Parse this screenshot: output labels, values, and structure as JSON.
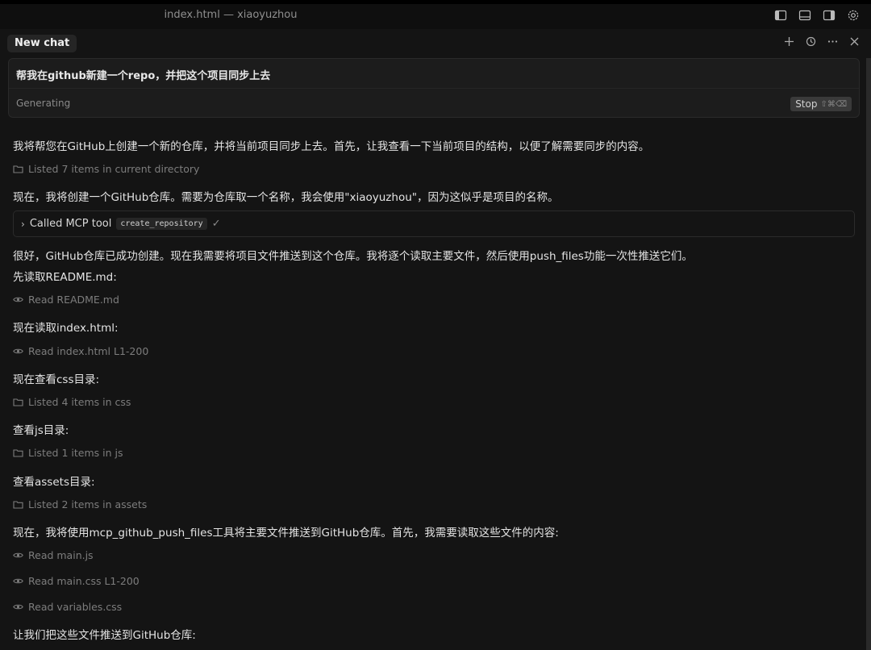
{
  "window": {
    "title": "index.html — xiaoyuzhou",
    "icons": [
      "sidebar-left-icon",
      "panel-bottom-icon",
      "sidebar-right-icon",
      "gear-icon"
    ]
  },
  "chat": {
    "tab_label": "New chat",
    "actions": [
      "plus-icon",
      "history-icon",
      "more-icon",
      "close-icon"
    ]
  },
  "prompt": {
    "text": "帮我在github新建一个repo，并把这个项目同步上去",
    "status": "Generating",
    "stop_label": "Stop",
    "stop_shortcut": "⇧⌘⌫"
  },
  "messages": [
    {
      "kind": "text",
      "text": "我将帮您在GitHub上创建一个新的仓库，并将当前项目同步上去。首先，让我查看一下当前项目的结构，以便了解需要同步的内容。"
    },
    {
      "kind": "action",
      "icon": "folder-icon",
      "text": "Listed 7 items in current directory"
    },
    {
      "kind": "text",
      "text": "现在，我将创建一个GitHub仓库。需要为仓库取一个名称，我会使用\"xiaoyuzhou\"，因为这似乎是项目的名称。"
    },
    {
      "kind": "tool",
      "label": "Called MCP tool",
      "tag": "create_repository",
      "check": "✓"
    },
    {
      "kind": "text",
      "text": "很好，GitHub仓库已成功创建。现在我需要将项目文件推送到这个仓库。我将逐个读取主要文件，然后使用push_files功能一次性推送它们。"
    },
    {
      "kind": "text",
      "text": "先读取README.md:"
    },
    {
      "kind": "action",
      "icon": "eye-icon",
      "text": "Read README.md"
    },
    {
      "kind": "text",
      "text": "现在读取index.html:"
    },
    {
      "kind": "action",
      "icon": "eye-icon",
      "text": "Read index.html L1-200"
    },
    {
      "kind": "text",
      "text": "现在查看css目录:"
    },
    {
      "kind": "action",
      "icon": "folder-icon",
      "text": "Listed 4 items in css"
    },
    {
      "kind": "text",
      "text": "查看js目录:"
    },
    {
      "kind": "action",
      "icon": "folder-icon",
      "text": "Listed 1 items in js"
    },
    {
      "kind": "text",
      "text": "查看assets目录:"
    },
    {
      "kind": "action",
      "icon": "folder-icon",
      "text": "Listed 2 items in assets"
    },
    {
      "kind": "text",
      "text": "现在，我将使用mcp_github_push_files工具将主要文件推送到GitHub仓库。首先，我需要读取这些文件的内容:"
    },
    {
      "kind": "action",
      "icon": "eye-icon",
      "text": "Read main.js"
    },
    {
      "kind": "action",
      "icon": "eye-icon",
      "text": "Read main.css L1-200"
    },
    {
      "kind": "action",
      "icon": "eye-icon",
      "text": "Read variables.css"
    },
    {
      "kind": "text",
      "text": "让我们把这些文件推送到GitHub仓库:"
    }
  ]
}
